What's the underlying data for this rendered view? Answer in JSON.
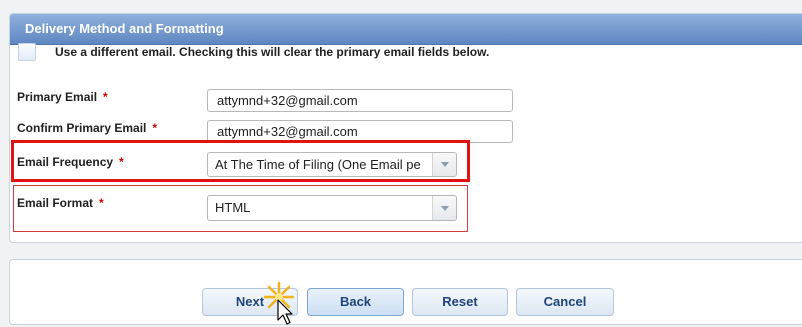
{
  "section": {
    "title": "Delivery Method and Formatting",
    "alt_email_checkbox_label": "Use a different email. Checking this will clear the primary email fields below."
  },
  "fields": {
    "primary_email": {
      "label": "Primary Email",
      "required_mark": "*",
      "value": "attymnd+32@gmail.com"
    },
    "confirm_email": {
      "label": "Confirm Primary Email",
      "required_mark": "*",
      "value": "attymnd+32@gmail.com"
    },
    "email_frequency": {
      "label": "Email Frequency",
      "required_mark": "*",
      "selected": "At The Time of Filing (One Email pe"
    },
    "email_format": {
      "label": "Email Format",
      "required_mark": "*",
      "selected": "HTML"
    }
  },
  "buttons": {
    "next": "Next",
    "back": "Back",
    "reset": "Reset",
    "cancel": "Cancel"
  },
  "colors": {
    "header_blue": "#6f95cc",
    "highlight_red": "#e31212",
    "required_red": "#d40000",
    "button_text": "#1f4479"
  },
  "icons": {
    "dropdown_arrow": "chevron-down-icon",
    "click_burst": "sparkle-icon",
    "mouse_pointer": "cursor-icon"
  }
}
